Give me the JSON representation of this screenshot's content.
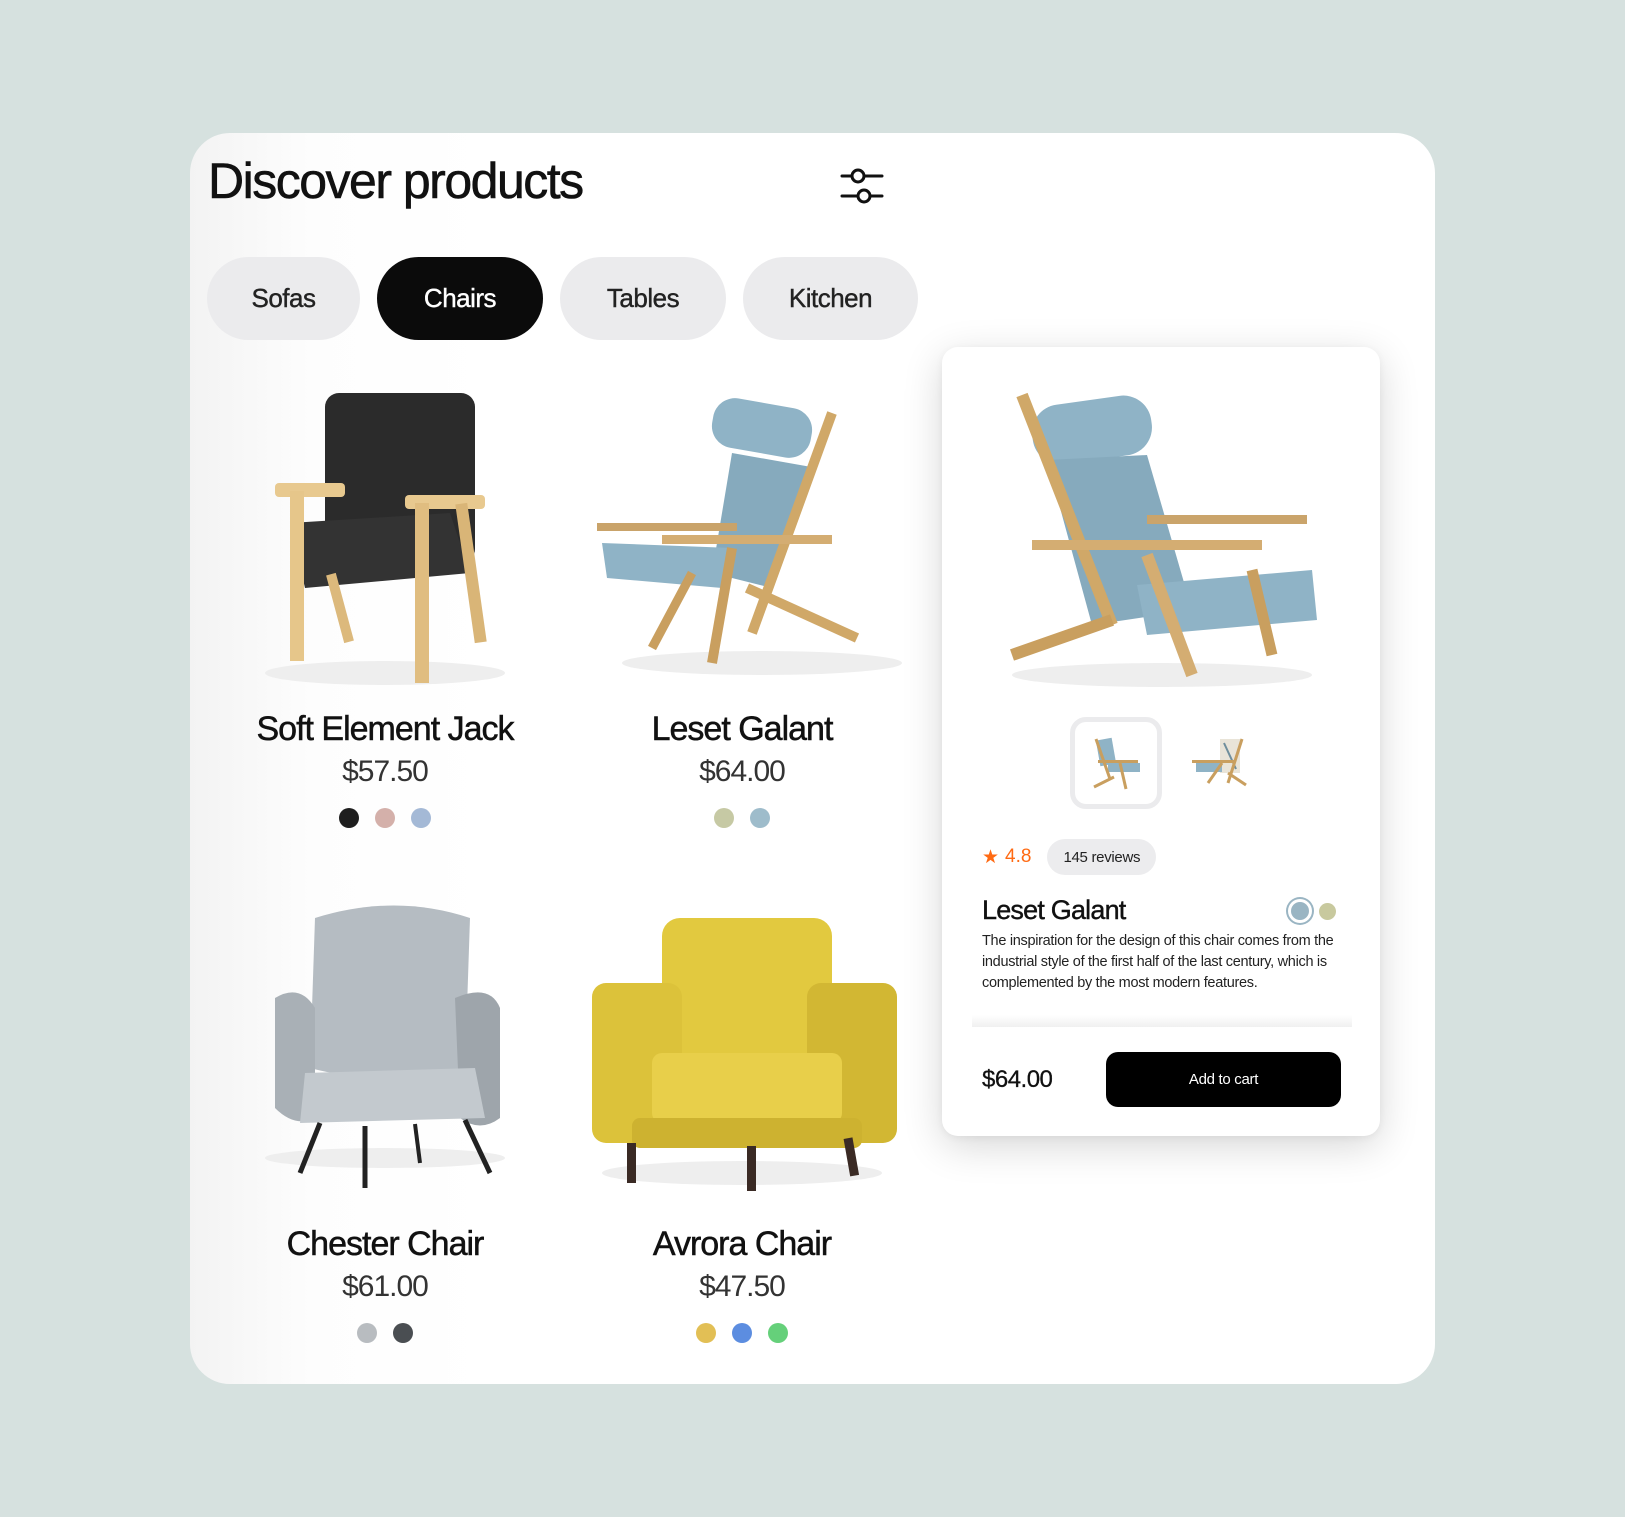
{
  "header": {
    "title": "Discover products",
    "filter_icon": "sliders-icon"
  },
  "categories": [
    {
      "label": "Sofas",
      "active": false
    },
    {
      "label": "Chairs",
      "active": true
    },
    {
      "label": "Tables",
      "active": false
    },
    {
      "label": "Kitchen",
      "active": false
    }
  ],
  "products": [
    {
      "name": "Soft Element Jack",
      "price": "$57.50",
      "swatches": [
        "#1e1e1e",
        "#d4b0aa",
        "#a4b9d6"
      ]
    },
    {
      "name": "Leset Galant",
      "price": "$64.00",
      "swatches": [
        "#c6c9a4",
        "#9ebccb"
      ]
    },
    {
      "name": "Chester Chair",
      "price": "$61.00",
      "swatches": [
        "#b8bcc0",
        "#4a4e52"
      ]
    },
    {
      "name": "Avrora Chair",
      "price": "$47.50",
      "swatches": [
        "#e2bf55",
        "#5c8de0",
        "#65d07a"
      ]
    }
  ],
  "detail": {
    "name": "Leset Galant",
    "rating": "4.8",
    "rating_icon": "star-icon",
    "reviews": "145 reviews",
    "description": "The inspiration for the design of this chair comes from the industrial style of the first half of the last century, which is complemented by the most modern features.",
    "price": "$64.00",
    "add_to_cart": "Add to cart",
    "colors": [
      "#9ab5c3",
      "#c8c99e"
    ],
    "selected_color": "#9ab5c3",
    "thumbnails": [
      "front-view",
      "back-view"
    ],
    "accent": "#ff6a13"
  }
}
